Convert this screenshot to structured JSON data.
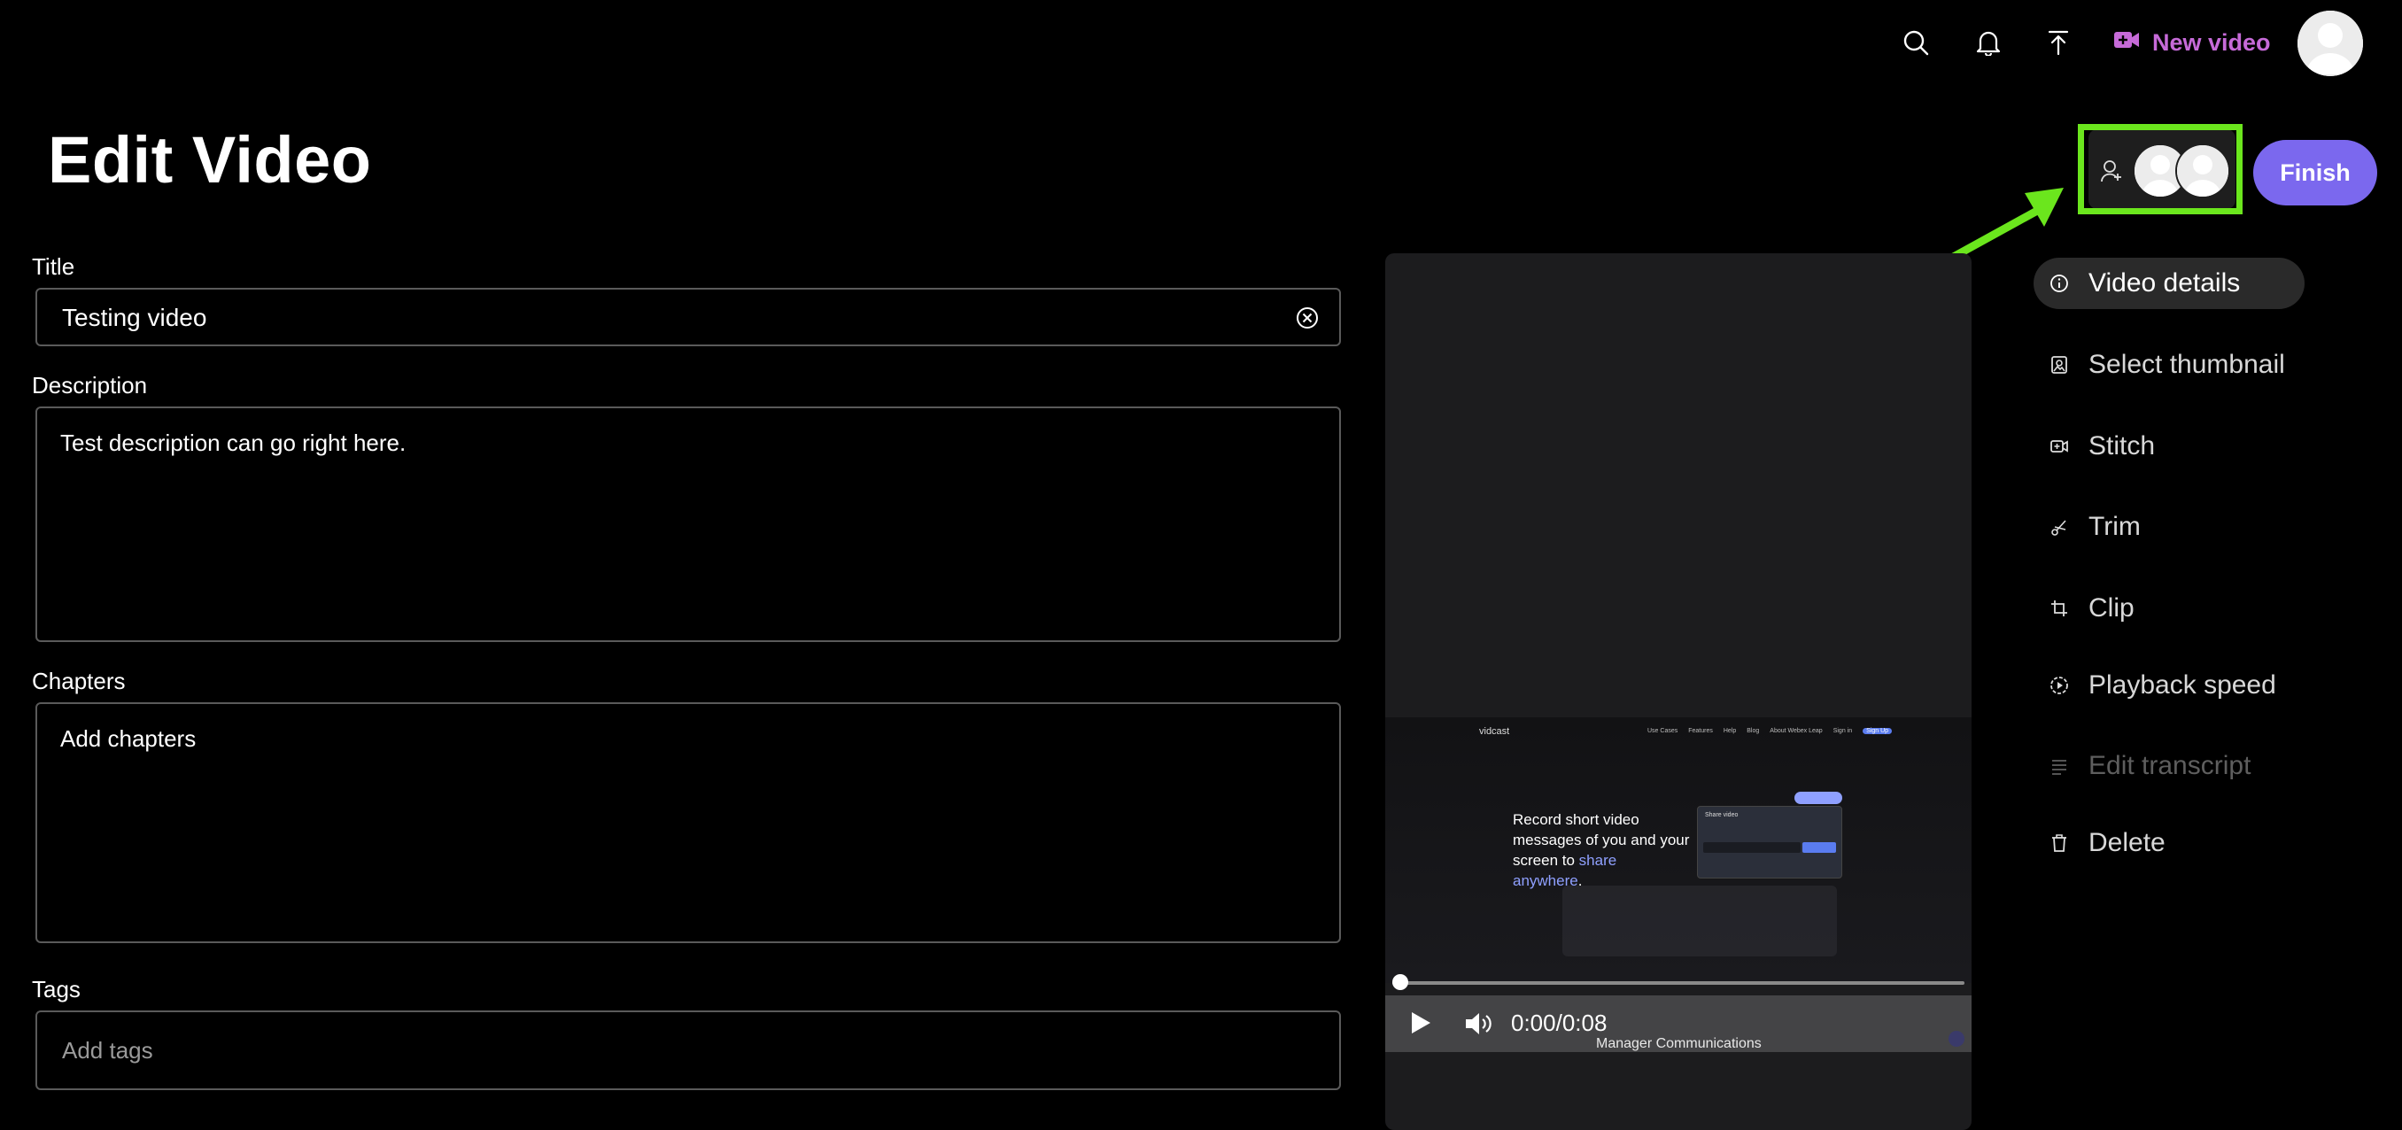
{
  "header": {
    "new_video_label": "New video",
    "icons": [
      "search-icon",
      "bell-icon",
      "upload-icon",
      "video-camera-icon"
    ]
  },
  "page": {
    "title": "Edit Video",
    "finish_label": "Finish"
  },
  "form": {
    "title_label": "Title",
    "title_value": "Testing video",
    "description_label": "Description",
    "description_value": "Test description can go right here.",
    "chapters_label": "Chapters",
    "chapters_placeholder": "Add chapters",
    "tags_label": "Tags",
    "tags_placeholder": "Add tags"
  },
  "video": {
    "time": "0:00/0:08",
    "progress": 0,
    "caption_overlay": "Manager Communications",
    "preview": {
      "logo": "vidcast",
      "nav": [
        "Use Cases",
        "Features",
        "Help",
        "Blog",
        "About Webex Leap",
        "Sign in",
        "Sign Up"
      ],
      "headline_part1": "Record short video messages of you and your screen to ",
      "headline_highlight": "share anywhere",
      "headline_end": ".",
      "dialog_title": "Share video"
    }
  },
  "sidebar": {
    "items": [
      {
        "label": "Video details",
        "icon": "info-icon",
        "state": "active"
      },
      {
        "label": "Select thumbnail",
        "icon": "thumbnail-icon",
        "state": "normal"
      },
      {
        "label": "Stitch",
        "icon": "stitch-icon",
        "state": "normal"
      },
      {
        "label": "Trim",
        "icon": "scissors-icon",
        "state": "normal"
      },
      {
        "label": "Clip",
        "icon": "crop-icon",
        "state": "normal"
      },
      {
        "label": "Playback speed",
        "icon": "playback-speed-icon",
        "state": "normal"
      },
      {
        "label": "Edit transcript",
        "icon": "transcript-icon",
        "state": "disabled"
      },
      {
        "label": "Delete",
        "icon": "trash-icon",
        "state": "normal"
      }
    ]
  },
  "annotation": {
    "highlight_color": "#6be61d",
    "target": "collaborators"
  },
  "colors": {
    "accent": "#7b68ee",
    "new_video": "#c66ad8",
    "link": "#8fa0ff"
  }
}
